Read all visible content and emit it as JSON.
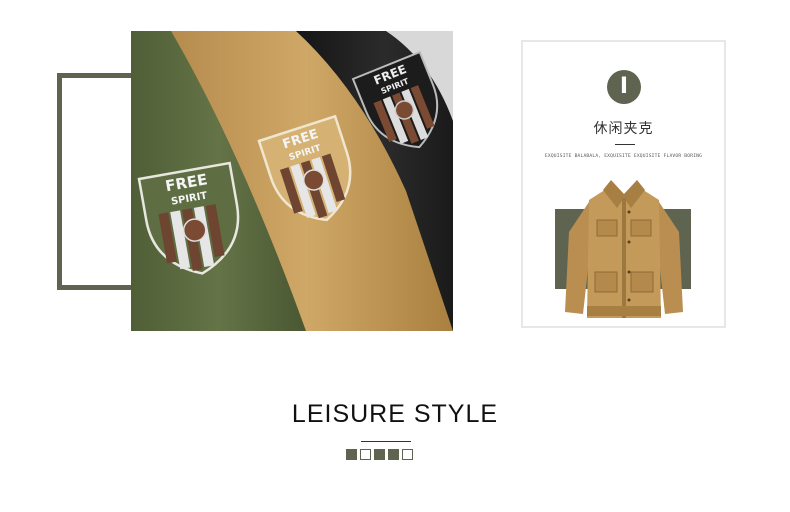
{
  "photo": {
    "badges": [
      {
        "line1": "FREE",
        "line2": "SPIRIT"
      },
      {
        "line1": "FREE",
        "line2": "SPIRIT"
      },
      {
        "line1": "FREE",
        "line2": "SPIRIT"
      }
    ],
    "icon": "embroidered-shield-icon"
  },
  "card": {
    "roman_numeral": "I",
    "title": "休闲夹克",
    "subtitle": "EXQUISITE BALABALA, EXQUISITE EXQUISITE FLAVOR BORING"
  },
  "heading": {
    "text": "LEISURE STYLE"
  },
  "squares": [
    "filled",
    "outline",
    "filled",
    "filled",
    "outline"
  ],
  "colors": {
    "accent": "#5e6450",
    "olive_sleeve": "#5a6a3f",
    "khaki_sleeve": "#c19a5b",
    "black_sleeve": "#1f1f1f",
    "jacket": "#c49a5a"
  }
}
